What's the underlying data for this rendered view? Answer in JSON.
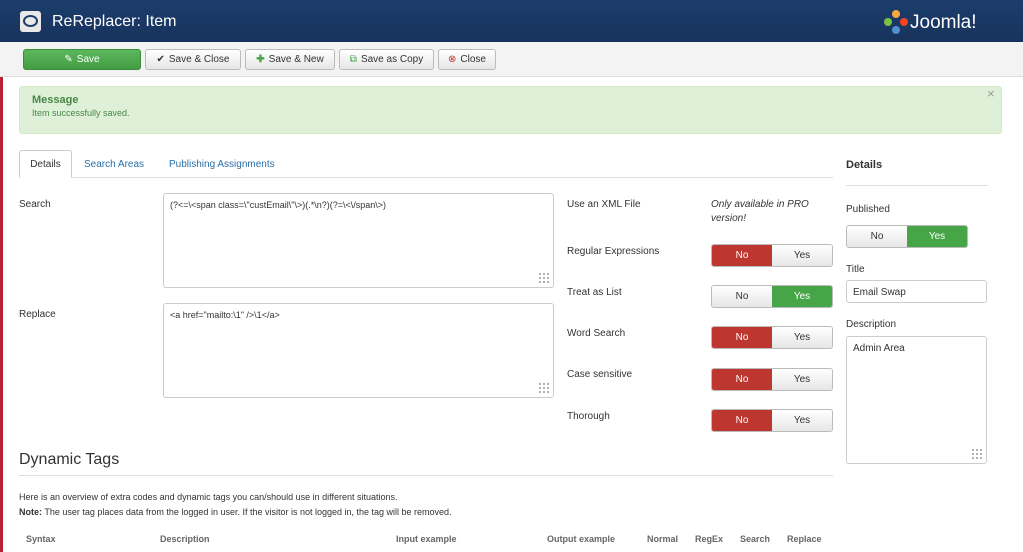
{
  "header": {
    "title": "ReReplacer: Item",
    "logo_text": "Joomla!",
    "app_icon": "rereplacer-icon"
  },
  "toolbar": {
    "save": "Save",
    "save_close": "Save & Close",
    "save_new": "Save & New",
    "save_copy": "Save as Copy",
    "close": "Close"
  },
  "message": {
    "heading": "Message",
    "text": "Item successfully saved.",
    "close": "×"
  },
  "tabs": [
    {
      "label": "Details",
      "active": true
    },
    {
      "label": "Search Areas",
      "active": false
    },
    {
      "label": "Publishing Assignments",
      "active": false
    }
  ],
  "form": {
    "search_label": "Search",
    "search_value": "(?<=\\<span class=\\\"custEmail\\\"\\>)(.*\\n?)(?=\\<\\/span\\>)",
    "replace_label": "Replace",
    "replace_value": "<a href=\"mailto:\\1\"  />\\1</a>",
    "xml_label": "Use an XML File",
    "xml_note": "Only available in PRO version!",
    "options": [
      {
        "label": "Regular Expressions",
        "no": "No",
        "yes": "Yes",
        "selected": "No"
      },
      {
        "label": "Treat as List",
        "no": "No",
        "yes": "Yes",
        "selected": "Yes"
      },
      {
        "label": "Word Search",
        "no": "No",
        "yes": "Yes",
        "selected": "No"
      },
      {
        "label": "Case sensitive",
        "no": "No",
        "yes": "Yes",
        "selected": "No"
      },
      {
        "label": "Thorough",
        "no": "No",
        "yes": "Yes",
        "selected": "No"
      }
    ]
  },
  "sidebar": {
    "heading": "Details",
    "published_label": "Published",
    "published_no": "No",
    "published_yes": "Yes",
    "published_selected": "Yes",
    "title_label": "Title",
    "title_value": "Email Swap",
    "description_label": "Description",
    "description_value": "Admin Area"
  },
  "dynamic_tags": {
    "title": "Dynamic Tags",
    "intro": "Here is an overview of extra codes and dynamic tags you can/should use in different situations.",
    "note_label": "Note:",
    "note_text": " The user tag places data from the logged in user. If the visitor is not logged in, the tag will be removed.",
    "columns": [
      "Syntax",
      "Description",
      "Input example",
      "Output example",
      "Normal",
      "RegEx",
      "Search",
      "Replace"
    ]
  },
  "colors": {
    "header": "#1c3d6c",
    "success": "#5cb85c",
    "danger": "#bd362f",
    "link": "#2a6fa8"
  }
}
